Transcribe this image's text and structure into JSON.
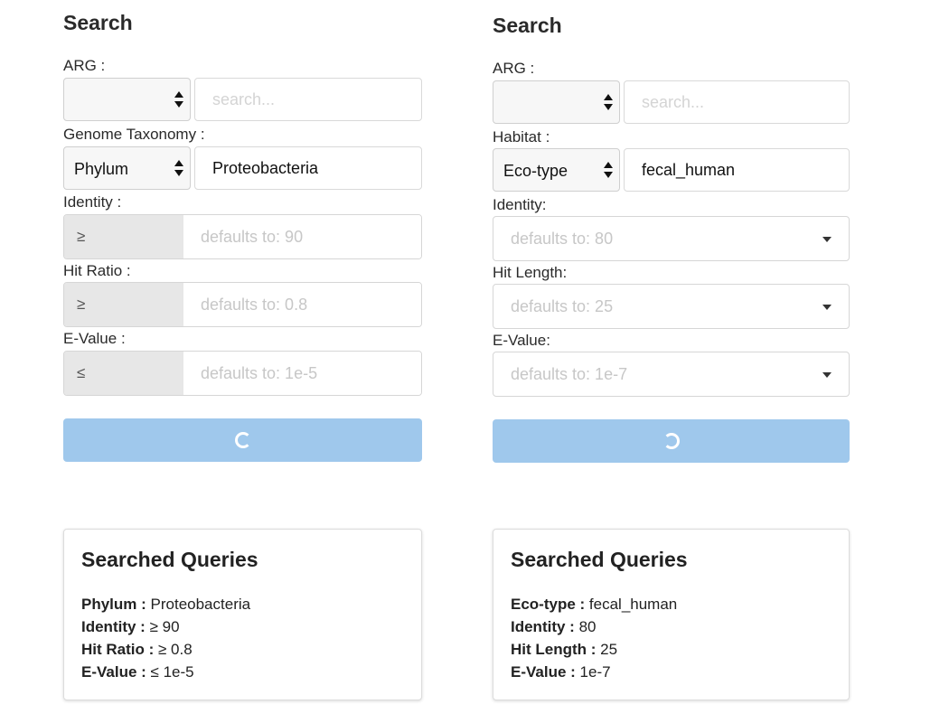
{
  "left": {
    "title": "Search",
    "arg_label": "ARG :",
    "arg_select_value": "",
    "arg_search_placeholder": "search...",
    "taxonomy_label": "Genome Taxonomy :",
    "taxonomy_select_value": "Phylum",
    "taxonomy_input_value": "Proteobacteria",
    "identity_label": "Identity :",
    "identity_operator": "≥",
    "identity_placeholder": "defaults to: 90",
    "hit_ratio_label": "Hit Ratio :",
    "hit_ratio_operator": "≥",
    "hit_ratio_placeholder": "defaults to: 0.8",
    "evalue_label": "E-Value :",
    "evalue_operator": "≤",
    "evalue_placeholder": "defaults to: 1e-5",
    "queries": {
      "title": "Searched Queries",
      "rows": [
        {
          "key": "Phylum :",
          "value": " Proteobacteria"
        },
        {
          "key": "Identity :",
          "value": " ≥ 90"
        },
        {
          "key": "Hit Ratio :",
          "value": " ≥ 0.8"
        },
        {
          "key": "E-Value :",
          "value": " ≤ 1e-5"
        }
      ]
    }
  },
  "right": {
    "title": "Search",
    "arg_label": "ARG :",
    "arg_select_value": "",
    "arg_search_placeholder": "search...",
    "habitat_label": "Habitat :",
    "habitat_select_value": "Eco-type",
    "habitat_input_value": "fecal_human",
    "identity_label": "Identity:",
    "identity_placeholder": "defaults to: 80",
    "hit_length_label": "Hit Length:",
    "hit_length_placeholder": "defaults to: 25",
    "evalue_label": "E-Value:",
    "evalue_placeholder": "defaults to: 1e-7",
    "queries": {
      "title": "Searched Queries",
      "rows": [
        {
          "key": "Eco-type :",
          "value": " fecal_human"
        },
        {
          "key": "Identity :",
          "value": " 80"
        },
        {
          "key": "Hit Length :",
          "value": " 25"
        },
        {
          "key": "E-Value :",
          "value": " 1e-7"
        }
      ]
    }
  },
  "colors": {
    "button_loading": "#9fc8ec",
    "addon_background": "#e7e7e7",
    "placeholder": "#c7c7c7"
  },
  "icons": {
    "loading": "spinner-icon",
    "select": "select-arrows-icon",
    "dropdown": "caret-down-icon"
  }
}
